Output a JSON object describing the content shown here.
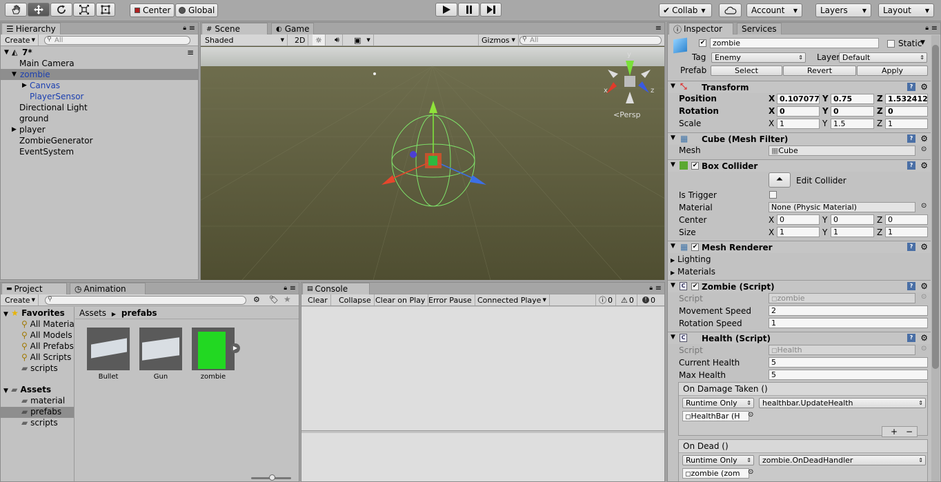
{
  "toolbar": {
    "tools": [
      "hand-tool",
      "move-tool",
      "rotate-tool",
      "scale-tool",
      "rect-tool"
    ],
    "center_label": "Center",
    "global_label": "Global",
    "collab_label": "Collab",
    "account_label": "Account",
    "layers_label": "Layers",
    "layout_label": "Layout"
  },
  "hierarchy": {
    "tab_label": "Hierarchy",
    "create_label": "Create",
    "search_placeholder": "All",
    "scene_name": "7*",
    "items": [
      {
        "label": "Main Camera"
      },
      {
        "label": "zombie"
      },
      {
        "label": "Canvas"
      },
      {
        "label": "PlayerSensor"
      },
      {
        "label": "Directional Light"
      },
      {
        "label": "ground"
      },
      {
        "label": "player"
      },
      {
        "label": "ZombieGenerator"
      },
      {
        "label": "EventSystem"
      }
    ]
  },
  "scene": {
    "tab_scene": "Scene",
    "tab_game": "Game",
    "shading": "Shaded",
    "mode_2d": "2D",
    "gizmos": "Gizmos",
    "search_placeholder": "All",
    "persp_label": "Persp",
    "axis_x": "x",
    "axis_y": "y",
    "axis_z": "z"
  },
  "project": {
    "tab_project": "Project",
    "tab_animation": "Animation",
    "create_label": "Create",
    "favorites_label": "Favorites",
    "favorites": [
      {
        "label": "All Materia"
      },
      {
        "label": "All Models"
      },
      {
        "label": "All Prefabs"
      },
      {
        "label": "All Scripts"
      },
      {
        "label": "scripts"
      }
    ],
    "assets_label": "Assets",
    "assets": [
      {
        "label": "material"
      },
      {
        "label": "prefabs"
      },
      {
        "label": "scripts"
      }
    ],
    "breadcrumb_root": "Assets",
    "breadcrumb_current": "prefabs",
    "files": [
      {
        "label": "Bullet"
      },
      {
        "label": "Gun"
      },
      {
        "label": "zombie"
      }
    ]
  },
  "console": {
    "tab_label": "Console",
    "buttons": {
      "clear": "Clear",
      "collapse": "Collapse",
      "clear_on_play": "Clear on Play",
      "error_pause": "Error Pause",
      "connected": "Connected Playe"
    },
    "count_info": "0",
    "count_warn": "0",
    "count_error": "0"
  },
  "inspector": {
    "tab_inspector": "Inspector",
    "tab_services": "Services",
    "object_name": "zombie",
    "static_label": "Static",
    "tag_label": "Tag",
    "tag_value": "Enemy",
    "layer_label": "Layer",
    "layer_value": "Default",
    "prefab_label": "Prefab",
    "prefab_select": "Select",
    "prefab_revert": "Revert",
    "prefab_apply": "Apply",
    "transform": {
      "title": "Transform",
      "position_label": "Position",
      "rotation_label": "Rotation",
      "scale_label": "Scale",
      "position": {
        "x": "0.107077",
        "y": "0.75",
        "z": "1.532412"
      },
      "rotation": {
        "x": "0",
        "y": "0",
        "z": "0"
      },
      "scale": {
        "x": "1",
        "y": "1.5",
        "z": "1"
      }
    },
    "mesh_filter": {
      "title": "Cube (Mesh Filter)",
      "mesh_label": "Mesh",
      "mesh_value": "Cube"
    },
    "box_collider": {
      "title": "Box Collider",
      "edit_label": "Edit Collider",
      "trigger_label": "Is Trigger",
      "material_label": "Material",
      "material_value": "None (Physic Material)",
      "center_label": "Center",
      "center": {
        "x": "0",
        "y": "0",
        "z": "0"
      },
      "size_label": "Size",
      "size": {
        "x": "1",
        "y": "1",
        "z": "1"
      }
    },
    "mesh_renderer": {
      "title": "Mesh Renderer",
      "lighting_label": "Lighting",
      "materials_label": "Materials"
    },
    "zombie_script": {
      "title": "Zombie (Script)",
      "script_label": "Script",
      "script_value": "zombie",
      "move_label": "Movement Speed",
      "move_value": "2",
      "rot_label": "Rotation Speed",
      "rot_value": "1"
    },
    "health_script": {
      "title": "Health (Script)",
      "script_label": "Script",
      "script_value": "Health",
      "current_label": "Current Health",
      "current_value": "5",
      "max_label": "Max Health",
      "max_value": "5",
      "on_damage_label": "On Damage Taken ()",
      "runtime_label": "Runtime Only",
      "damage_handler": "healthbar.UpdateHealth",
      "damage_target": "HealthBar (H",
      "on_dead_label": "On Dead ()",
      "dead_handler": "zombie.OnDeadHandler",
      "dead_target": "zombie (zom",
      "plus_label": "+",
      "minus_label": "−"
    }
  },
  "colors": {
    "selection": "#8e8e8e",
    "link_blue": "#1b3fb0",
    "ground": "#5b5a3a",
    "sky": "#c9ccc9"
  }
}
